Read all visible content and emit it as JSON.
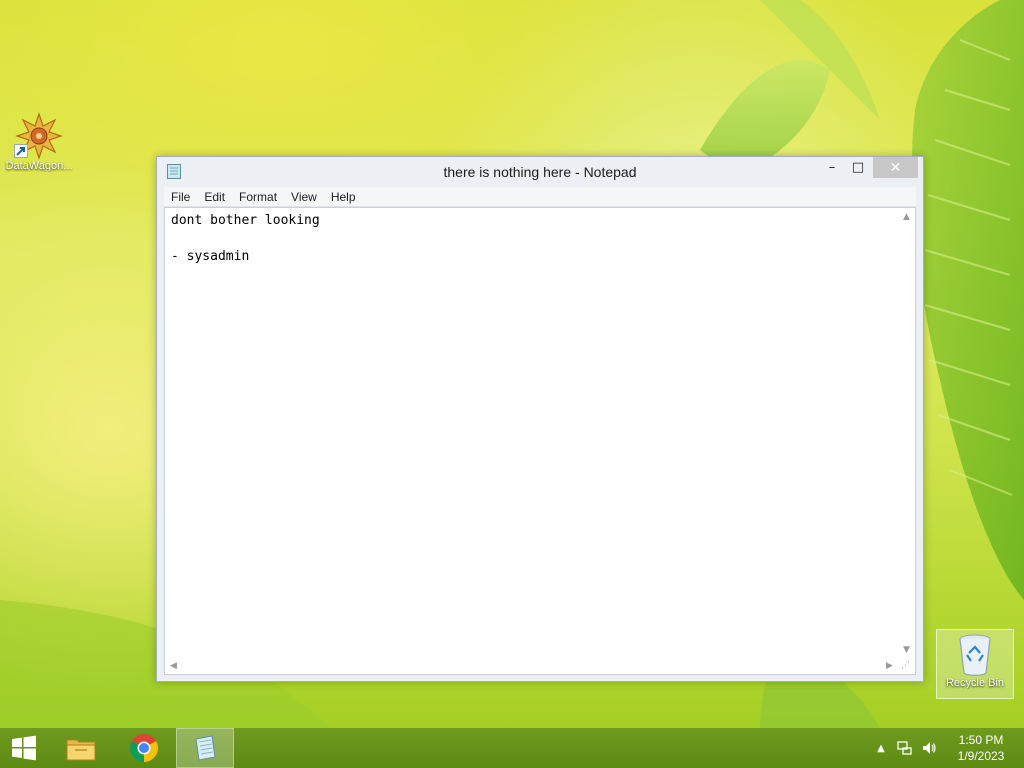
{
  "desktop": {
    "icons": [
      {
        "label": "DataWagon...",
        "icon": "datawagon-icon"
      },
      {
        "label": "Recycle Bin",
        "icon": "recycle-bin-icon"
      }
    ]
  },
  "window": {
    "title": "there is nothing here - Notepad",
    "controls": {
      "minimize": "–",
      "maximize": "□",
      "close": "✕"
    },
    "menu": [
      "File",
      "Edit",
      "Format",
      "View",
      "Help"
    ],
    "content": "dont bother looking\n\n- sysadmin"
  },
  "taskbar": {
    "pinned": [
      "start-icon",
      "file-explorer-icon",
      "chrome-icon",
      "notepad-icon"
    ],
    "active_app": "notepad-icon",
    "tray": {
      "icons": [
        "show-hidden-icons-chevron",
        "network-icon",
        "volume-icon"
      ],
      "time": "1:50 PM",
      "date": "1/9/2023"
    }
  },
  "colors": {
    "taskbar": "#6a9619",
    "desktop_accent": "#d9e23a",
    "close_button": "#c7c7c7"
  }
}
